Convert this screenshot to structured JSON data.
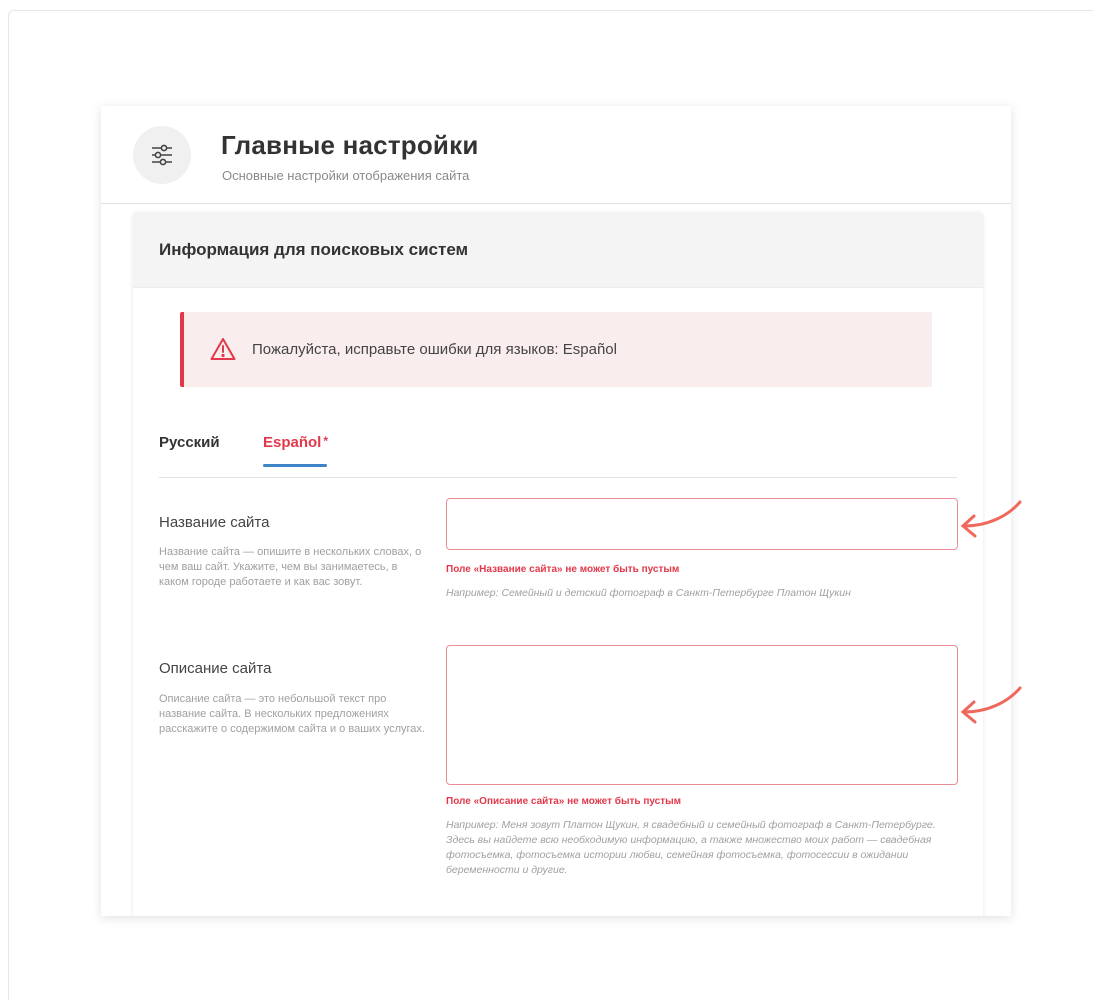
{
  "header": {
    "title": "Главные настройки",
    "subtitle": "Основные настройки отображения сайта",
    "icon": "sliders-icon"
  },
  "section": {
    "title": "Информация для поисковых систем"
  },
  "alert": {
    "text": "Пожалуйста, исправьте ошибки для языков: Español",
    "icon": "warning-triangle-icon",
    "color": "#e2394a"
  },
  "tabs": [
    {
      "label": "Русский",
      "active": false
    },
    {
      "label": "Español",
      "active": true,
      "has_error": true,
      "marker": "*"
    }
  ],
  "fields": {
    "site_name": {
      "label": "Название сайта",
      "help": "Название сайта — опишите в нескольких словах, о чем ваш сайт. Укажите, чем вы занимаетесь, в каком городе работаете и как вас зовут.",
      "value": "",
      "error": "Поле «Название сайта» не может быть пустым",
      "example": "Например: Семейный и детский фотограф в Санкт-Петербурге Платон Щукин"
    },
    "site_description": {
      "label": "Описание сайта",
      "help": "Описание сайта — это небольшой текст про название сайта. В нескольких предложениях расскажите о содержимом сайта и о ваших услугах.",
      "value": "",
      "error": "Поле «Описание сайта» не может быть пустым",
      "example": "Например: Меня зовут Платон Щукин, я свадебный и семейный фотограф в Санкт-Петербурге. Здесь вы найдете всю необходимую информацию, а также множество моих работ — свадебная фотосъемка, фотосъемка истории любви, семейная фотосъемка, фотосессии в ожидании беременности и другие."
    }
  },
  "colors": {
    "error": "#e2394a",
    "tab_underline": "#3d83c5",
    "alert_bg": "#faeded",
    "annotation_arrow": "#f0685c"
  }
}
